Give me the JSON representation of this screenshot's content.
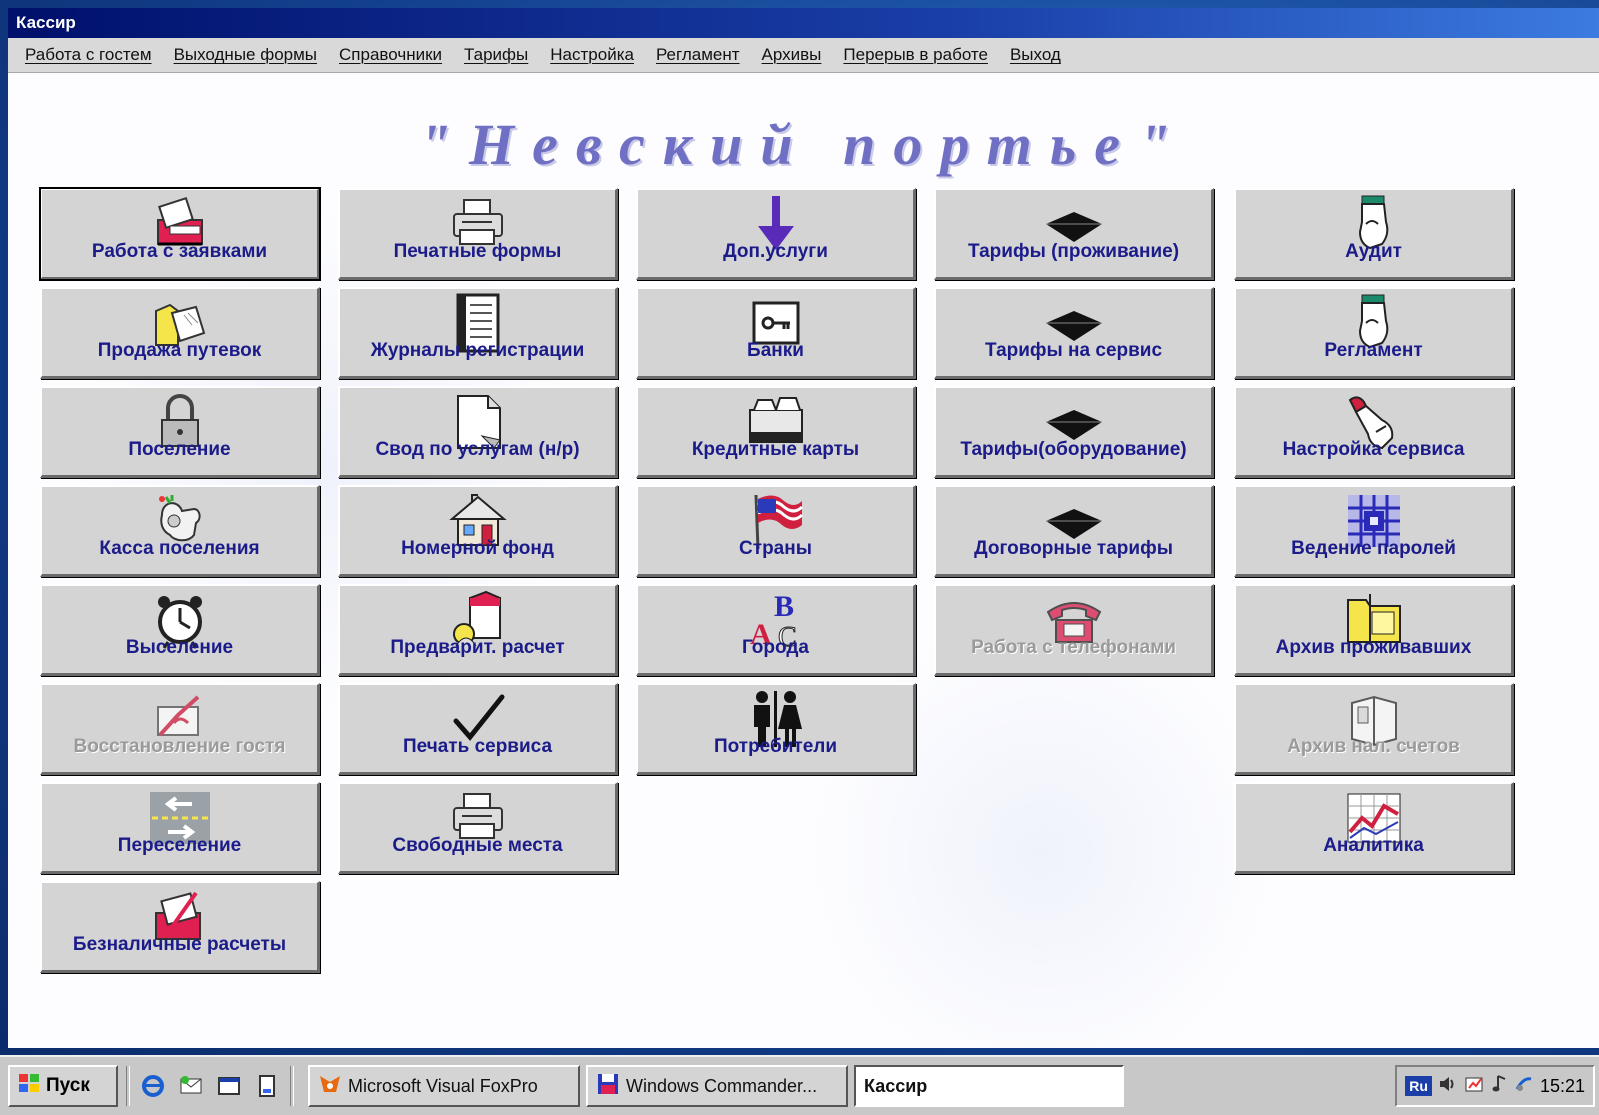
{
  "window": {
    "title": "Кассир"
  },
  "menu": [
    "Работа с гостем",
    "Выходные формы",
    "Справочники",
    "Тарифы",
    "Настройка",
    "Регламент",
    "Архивы",
    "Перерыв в работе",
    "Выход"
  ],
  "app_title": "\"Невский портье\"",
  "columns": [
    [
      {
        "label": "Работа с заявками",
        "icon": "register-icon",
        "focused": true
      },
      {
        "label": "Продажа путевок",
        "icon": "folder-icon"
      },
      {
        "label": "Поселение",
        "icon": "padlock-icon"
      },
      {
        "label": "Касса поселения",
        "icon": "cash-icon"
      },
      {
        "label": "Выселение",
        "icon": "alarm-clock-icon"
      },
      {
        "label": "Восстановление гостя",
        "icon": "restore-icon",
        "disabled": true
      },
      {
        "label": "Переселение",
        "icon": "arrows-icon"
      },
      {
        "label": "Безналичные расчеты",
        "icon": "cashless-icon"
      }
    ],
    [
      {
        "label": "Печатные формы",
        "icon": "printer-icon"
      },
      {
        "label": "Журналы регистрации",
        "icon": "notebook-icon"
      },
      {
        "label": "Свод по услугам (н/р)",
        "icon": "document-icon"
      },
      {
        "label": "Номерной фонд",
        "icon": "house-icon"
      },
      {
        "label": "Предварит. расчет",
        "icon": "calculation-icon"
      },
      {
        "label": "Печать сервиса",
        "icon": "checkmark-icon"
      },
      {
        "label": "Свободные места",
        "icon": "printer-icon"
      }
    ],
    [
      {
        "label": "Доп.услуги",
        "icon": "arrow-down-icon"
      },
      {
        "label": "Банки",
        "icon": "key-icon"
      },
      {
        "label": "Кредитные карты",
        "icon": "card-file-icon"
      },
      {
        "label": "Страны",
        "icon": "flag-icon"
      },
      {
        "label": "Города",
        "icon": "letters-icon"
      },
      {
        "label": "Потребители",
        "icon": "people-icon"
      }
    ],
    [
      {
        "label": "Тарифы (проживание)",
        "icon": "diamond-icon"
      },
      {
        "label": "Тарифы на сервис",
        "icon": "diamond-icon"
      },
      {
        "label": "Тарифы(оборудование)",
        "icon": "diamond-icon"
      },
      {
        "label": "Договорные тарифы",
        "icon": "diamond-icon"
      },
      {
        "label": "Работа с телефонами",
        "icon": "telephone-icon",
        "disabled": true
      }
    ],
    [
      {
        "label": "Аудит",
        "icon": "hand-icon"
      },
      {
        "label": "Регламент",
        "icon": "hand-icon"
      },
      {
        "label": "Настройка сервиса",
        "icon": "pointing-hand-icon"
      },
      {
        "label": "Ведение паролей",
        "icon": "grid-icon"
      },
      {
        "label": "Архив проживавших",
        "icon": "archive-folder-icon"
      },
      {
        "label": "Архив нал. счетов",
        "icon": "book-icon",
        "disabled": true
      },
      {
        "label": "Аналитика",
        "icon": "chart-icon"
      }
    ]
  ],
  "taskbar": {
    "start": "Пуск",
    "tasks": [
      {
        "label": "Microsoft Visual FoxPro",
        "icon": "foxpro-icon"
      },
      {
        "label": "Windows Commander...",
        "icon": "floppy-icon"
      },
      {
        "label": "Кассир",
        "active": true
      }
    ],
    "lang": "Ru",
    "clock": "15:21"
  },
  "colors": {
    "label": "#1b1b8a",
    "disabled": "#9a9a9a",
    "title": "#6f6fc4"
  }
}
